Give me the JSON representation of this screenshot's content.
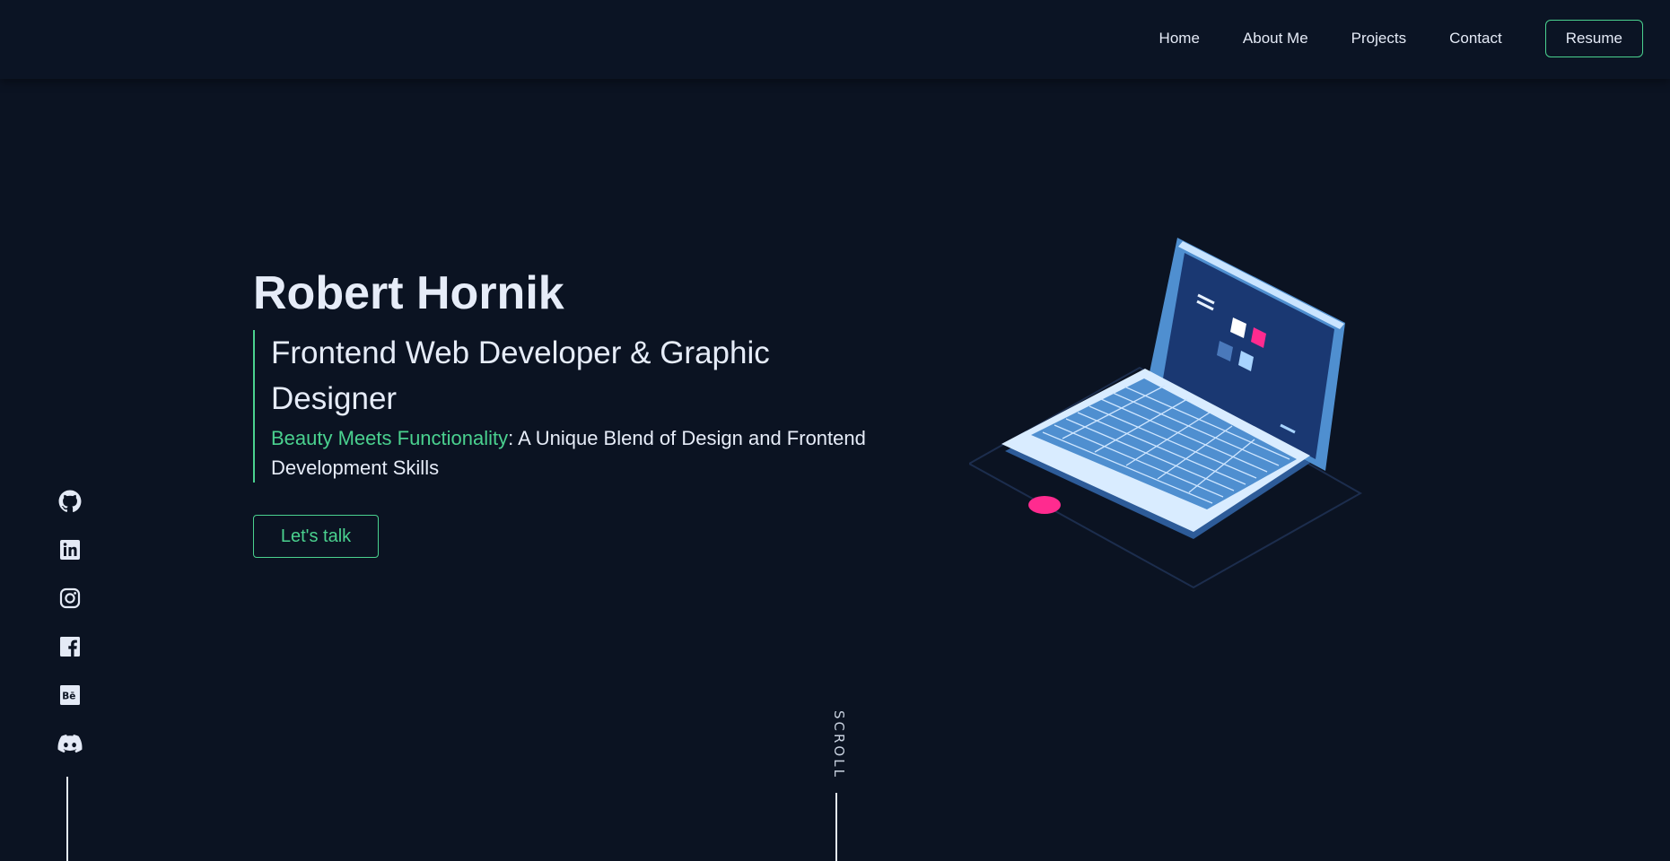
{
  "nav": {
    "items": [
      "Home",
      "About Me",
      "Projects",
      "Contact"
    ],
    "resume_label": "Resume"
  },
  "hero": {
    "name": "Robert Hornik",
    "title": "Frontend Web Developer & Graphic Designer",
    "tagline_accent": "Beauty Meets Functionality",
    "tagline_rest": ": A Unique Blend of Design and Frontend Development Skills",
    "cta_label": "Let's talk"
  },
  "socials": [
    "github-icon",
    "linkedin-icon",
    "instagram-icon",
    "facebook-icon",
    "behance-icon",
    "discord-icon"
  ],
  "scroll": {
    "label": "SCROLL"
  },
  "colors": {
    "background": "#0b1322",
    "accent": "#4ad18f",
    "text": "#e6ecf8",
    "laptop_screen": "#1a3872",
    "pink": "#ff2b8f"
  }
}
